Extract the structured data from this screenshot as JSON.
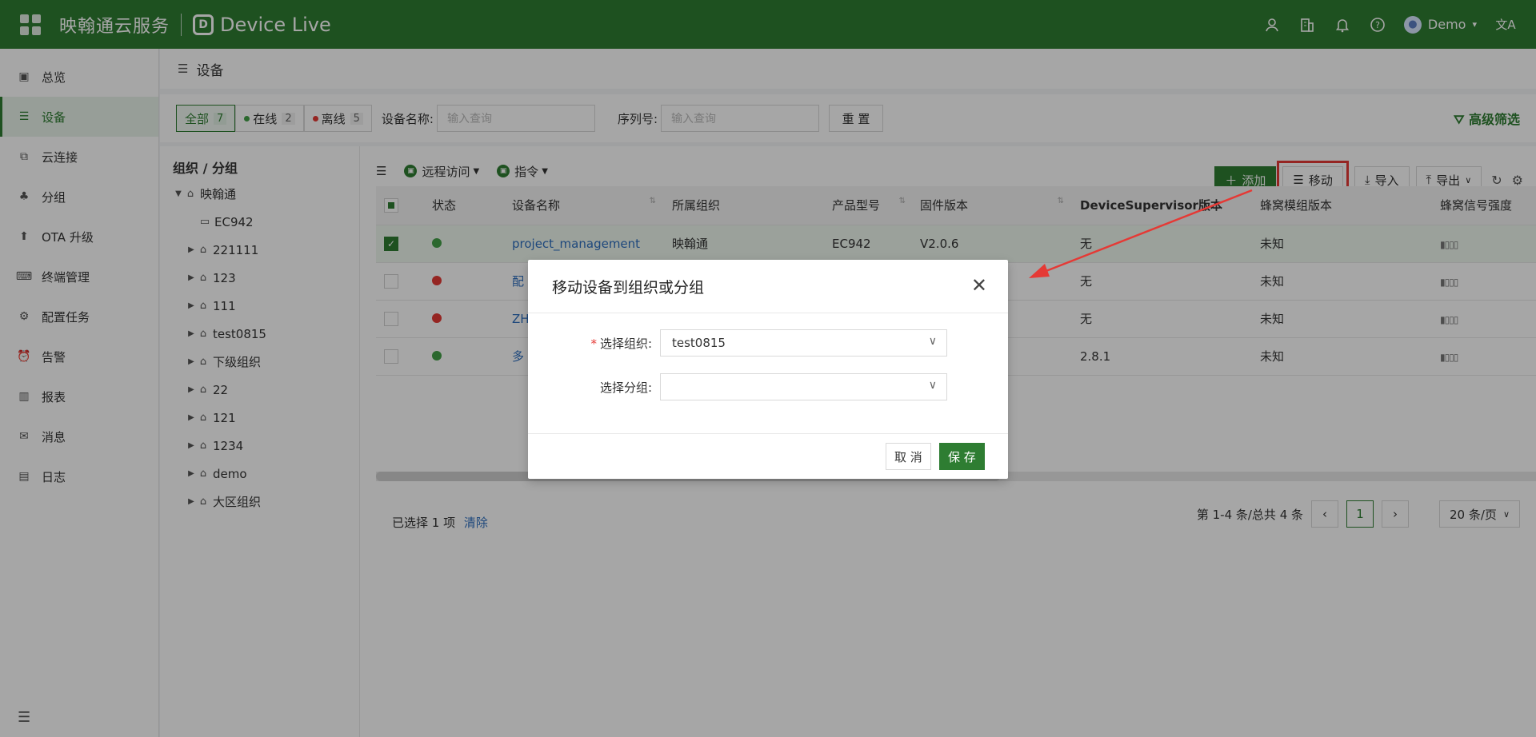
{
  "topbar": {
    "brand": "映翰通云服务",
    "logo_letter": "D",
    "product": "Device Live",
    "user": "Demo",
    "user_caret": "▾",
    "translate_glyph": "文A"
  },
  "sidebar": {
    "items": [
      {
        "label": "总览",
        "icon": "monitor-icon"
      },
      {
        "label": "设备",
        "icon": "device-list-icon"
      },
      {
        "label": "云连接",
        "icon": "cloud-link-icon"
      },
      {
        "label": "分组",
        "icon": "group-icon"
      },
      {
        "label": "OTA 升级",
        "icon": "upload-arrow-icon"
      },
      {
        "label": "终端管理",
        "icon": "keyboard-icon"
      },
      {
        "label": "配置任务",
        "icon": "config-icon"
      },
      {
        "label": "告警",
        "icon": "alarm-icon"
      },
      {
        "label": "报表",
        "icon": "report-icon"
      },
      {
        "label": "消息",
        "icon": "message-icon"
      },
      {
        "label": "日志",
        "icon": "log-icon"
      }
    ],
    "active_index": 1
  },
  "page": {
    "title": "设备"
  },
  "filters": {
    "all": {
      "label": "全部",
      "count": "7"
    },
    "online": {
      "label": "在线",
      "count": "2"
    },
    "offline": {
      "label": "离线",
      "count": "5"
    },
    "name_label": "设备名称:",
    "name_placeholder": "输入查询",
    "serial_label": "序列号:",
    "serial_placeholder": "输入查询",
    "reset_label": "重 置",
    "advanced_label": "高级筛选"
  },
  "tree": {
    "title": "组织 / 分组",
    "root": "映翰通",
    "nodes": [
      "EC942",
      "221111",
      "123",
      "111",
      "test0815",
      "下级组织",
      "22",
      "121",
      "1234",
      "demo",
      "大区组织"
    ]
  },
  "toolbar": {
    "remote_access": "远程访问",
    "command": "指令",
    "add": "添加",
    "move": "移动",
    "import": "导入",
    "export": "导出"
  },
  "table": {
    "headers": [
      "状态",
      "设备名称",
      "所属组织",
      "产品型号",
      "固件版本",
      "DeviceSupervisor版本",
      "蜂窝模组版本",
      "蜂窝信号强度"
    ],
    "rows": [
      {
        "status_color": "#43a047",
        "name": "project_management",
        "org": "映翰通",
        "model": "EC942",
        "firmware": "V2.0.6",
        "ds": "无",
        "module": "未知",
        "checked": true
      },
      {
        "status_color": "#e53935",
        "name": "配",
        "org": "",
        "model": "",
        "firmware": "",
        "ds": "无",
        "module": "未知",
        "checked": false
      },
      {
        "status_color": "#e53935",
        "name": "ZH",
        "org": "",
        "model": "",
        "firmware": "",
        "ds": "无",
        "module": "未知",
        "checked": false
      },
      {
        "status_color": "#43a047",
        "name": "多",
        "org": "",
        "model": "",
        "firmware": "",
        "ds": "2.8.1",
        "module": "未知",
        "checked": false
      }
    ]
  },
  "footer": {
    "selected_text": "已选择 1 项",
    "clear": "清除",
    "range": "第 1-4 条/总共 4 条",
    "page": "1",
    "page_size": "20 条/页"
  },
  "modal": {
    "title": "移动设备到组织或分组",
    "org_label": "选择组织:",
    "org_value": "test0815",
    "group_label": "选择分组:",
    "group_value": "",
    "cancel": "取 消",
    "save": "保 存"
  },
  "colors": {
    "brand": "#2e7d32",
    "online": "#43a047",
    "offline": "#e53935",
    "annotation": "#e53935"
  }
}
